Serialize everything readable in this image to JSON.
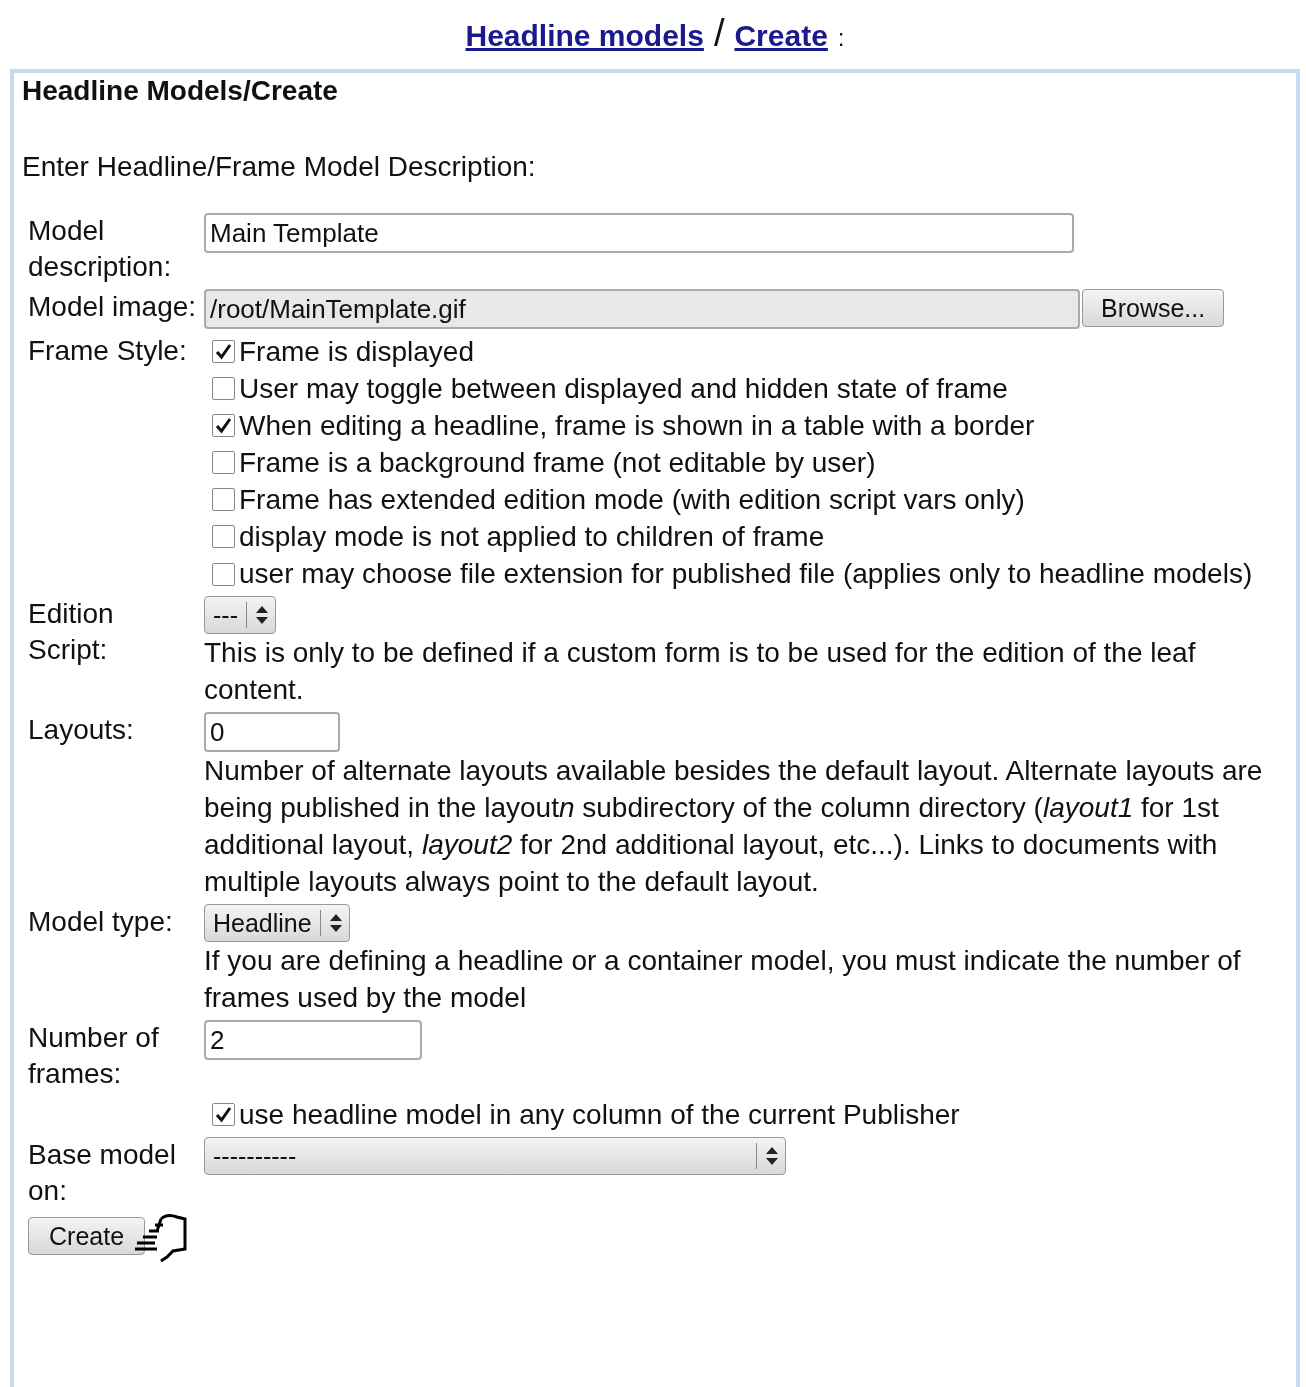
{
  "breadcrumb": {
    "links": [
      "Headline models",
      "Create"
    ],
    "separator": "/",
    "suffix": ":"
  },
  "panel": {
    "title": "Headline Models/Create",
    "intro": "Enter Headline/Frame Model Description:"
  },
  "rows": [
    {
      "label": "Model description:",
      "controls": [
        {
          "kind": "text",
          "value": "Main Template"
        }
      ]
    },
    {
      "label": "Model image:",
      "controls": [
        {
          "kind": "file",
          "value": "/root/MainTemplate.gif",
          "button": "Browse..."
        }
      ]
    },
    {
      "label": "Frame Style:",
      "controls": [
        {
          "kind": "checkbox",
          "text": "Frame is displayed",
          "checked": true
        },
        {
          "kind": "checkbox",
          "text": "User may toggle between displayed and hidden state of frame",
          "checked": false
        },
        {
          "kind": "checkbox",
          "text": "When editing a headline, frame is shown in a table with a border",
          "checked": true
        },
        {
          "kind": "checkbox",
          "text": "Frame is a background frame (not editable by user)",
          "checked": false
        },
        {
          "kind": "checkbox",
          "text": "Frame has extended edition mode (with edition script vars only)",
          "checked": false
        },
        {
          "kind": "checkbox",
          "text": "display mode is not applied to children of frame",
          "checked": false
        },
        {
          "kind": "checkbox",
          "text": "user may choose file extension for published file (applies only to headline models)",
          "checked": false
        }
      ]
    },
    {
      "label": "Edition Script:",
      "controls": [
        {
          "kind": "select",
          "value": "---"
        },
        {
          "kind": "help",
          "text": "This is only to be defined if a custom form is to be used for the edition of the leaf content."
        }
      ]
    },
    {
      "label": "Layouts:",
      "controls": [
        {
          "kind": "text",
          "value": "0"
        },
        {
          "kind": "help",
          "parts": [
            {
              "text": "Number of alternate layouts available besides the default layout. Alternate layouts are being published in the layout",
              "italic": false
            },
            {
              "text": "n",
              "italic": true
            },
            {
              "text": " subdirectory of the column directory (",
              "italic": false
            },
            {
              "text": "layout1",
              "italic": true
            },
            {
              "text": " for 1st additional layout, ",
              "italic": false
            },
            {
              "text": "layout2",
              "italic": true
            },
            {
              "text": " for 2nd additional layout, etc...). Links to documents with multiple layouts always point to the default layout.",
              "italic": false
            }
          ]
        }
      ]
    },
    {
      "label": "Model type:",
      "controls": [
        {
          "kind": "select",
          "value": "Headline"
        },
        {
          "kind": "help",
          "text": "If you are defining a headline or a container model, you must indicate the number of frames used by the model"
        }
      ]
    },
    {
      "label": "Number of frames:",
      "controls": [
        {
          "kind": "text",
          "value": "2"
        }
      ]
    },
    {
      "controls": [
        {
          "kind": "checkbox",
          "text": "use headline model in any column of the current Publisher",
          "checked": true
        }
      ]
    },
    {
      "label": "Base model on:",
      "controls": [
        {
          "kind": "select",
          "value": "----------"
        }
      ]
    }
  ],
  "submit": "Create"
}
